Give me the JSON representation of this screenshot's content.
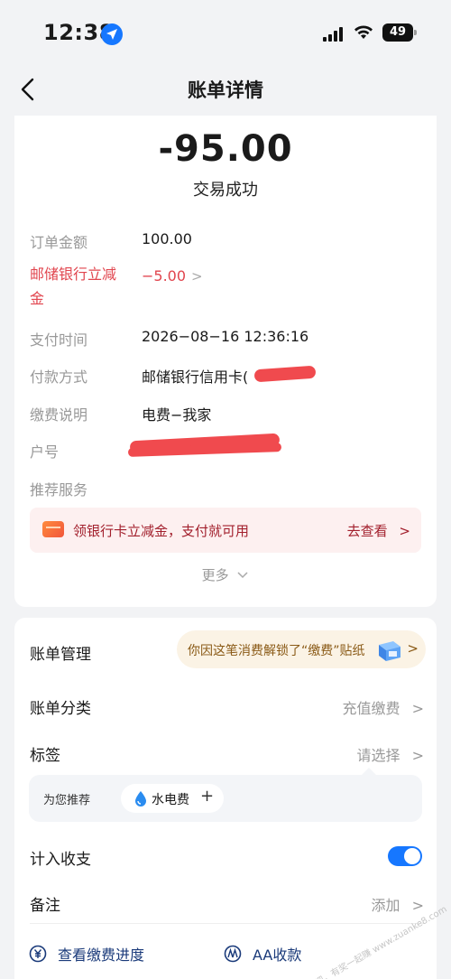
{
  "status_bar": {
    "time": "12:38",
    "battery": "49"
  },
  "nav": {
    "title": "账单详情"
  },
  "transaction": {
    "amount": "-95.00",
    "status": "交易成功",
    "rows": {
      "order_amount_label": "订单金额",
      "order_amount": "100.00",
      "discount_label_line1": "邮储银行立减",
      "discount_label_line2": "金",
      "discount_value": "−5.00",
      "pay_time_label": "支付时间",
      "pay_time": "2026−08−16 12:36:16",
      "pay_method_label": "付款方式",
      "pay_method": "邮储银行信用卡(",
      "pay_desc_label": "缴费说明",
      "pay_desc": "电费−我家",
      "account_label": "户号",
      "recommend_label": "推荐服务"
    },
    "promo": {
      "text": "领银行卡立减金，支付就可用",
      "link": "去查看"
    },
    "more": "更多"
  },
  "manage": {
    "title": "账单管理",
    "sticker": "你因这笔消费解锁了“缴费”贴纸",
    "category_label": "账单分类",
    "category_value": "充值缴费",
    "tag_label": "标签",
    "tag_value": "请选择",
    "recommend_label": "为您推荐",
    "recommend_chip": "水电费",
    "include_label": "计入收支",
    "include_enabled": true,
    "note_label": "备注",
    "note_value": "添加",
    "action_progress": "查看缴费进度",
    "action_aa": "AA收款"
  },
  "watermark": "赚客吧，有奖一起赚 www.zuanke8.com",
  "colors": {
    "accent": "#1677ff",
    "discount_red": "#e1454e",
    "promo_text": "#a21f2c",
    "redaction": "#f04a4e"
  }
}
